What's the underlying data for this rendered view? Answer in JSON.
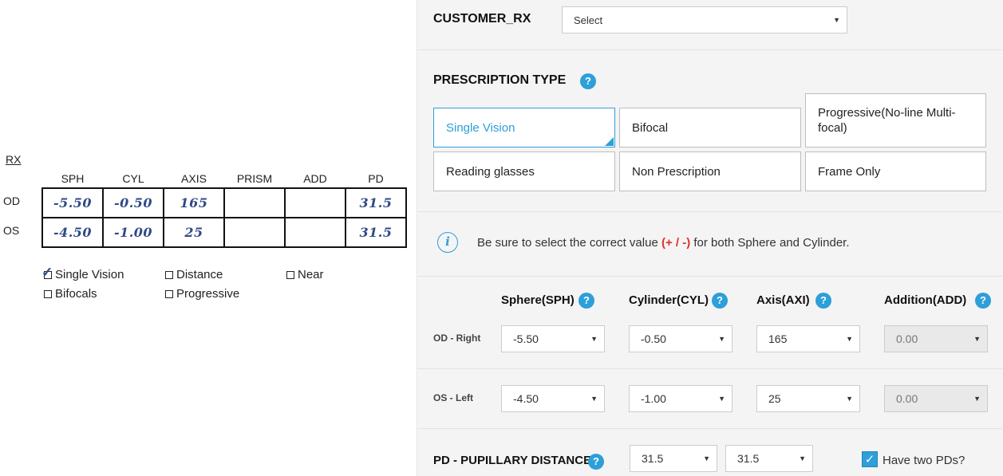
{
  "rx_form": {
    "title": "RX",
    "columns": [
      "SPH",
      "CYL",
      "AXIS",
      "PRISM",
      "ADD",
      "PD"
    ],
    "rows": [
      {
        "label": "OD",
        "values": [
          "-5.50",
          "-0.50",
          "165",
          "",
          "",
          "31.5"
        ]
      },
      {
        "label": "OS",
        "values": [
          "-4.50",
          "-1.00",
          "25",
          "",
          "",
          "31.5"
        ]
      }
    ],
    "checkboxes": [
      {
        "label": "Single Vision",
        "checked": true
      },
      {
        "label": "Distance",
        "checked": false
      },
      {
        "label": "Near",
        "checked": false
      },
      {
        "label": "Bifocals",
        "checked": false
      },
      {
        "label": "Progressive",
        "checked": false
      }
    ]
  },
  "customer_rx": {
    "label": "CUSTOMER_RX",
    "select_value": "Select"
  },
  "prescription_type": {
    "label": "PRESCRIPTION TYPE",
    "help_icon": "?",
    "options": [
      {
        "label": "Single Vision",
        "selected": true
      },
      {
        "label": "Bifocal",
        "selected": false
      },
      {
        "label": "Progressive(No-line Multi-focal)",
        "selected": false
      },
      {
        "label": "Reading glasses",
        "selected": false
      },
      {
        "label": "Non Prescription",
        "selected": false
      },
      {
        "label": "Frame Only",
        "selected": false
      }
    ]
  },
  "notice": {
    "icon": "i",
    "text_before": "Be sure to select the correct value ",
    "highlight": "(+ / -)",
    "text_after": " for both Sphere and Cylinder."
  },
  "rx_fields": {
    "help_icon": "?",
    "headers": [
      "Sphere(SPH)",
      "Cylinder(CYL)",
      "Axis(AXI)",
      "Addition(ADD)"
    ],
    "od_label": "OD - Right",
    "os_label": "OS - Left",
    "od_values": [
      "-5.50",
      "-0.50",
      "165",
      "0.00"
    ],
    "os_values": [
      "-4.50",
      "-1.00",
      "25",
      "0.00"
    ]
  },
  "pd": {
    "label": "PD - PUPILLARY DISTANCE",
    "help_icon": "?",
    "values": [
      "31.5",
      "31.5"
    ],
    "two_pds_label": "Have two PDs?",
    "two_pds_checked": true
  },
  "colors": {
    "accent": "#2d9fd9",
    "warning": "#e0302a",
    "handwriting": "#2f4a86"
  }
}
